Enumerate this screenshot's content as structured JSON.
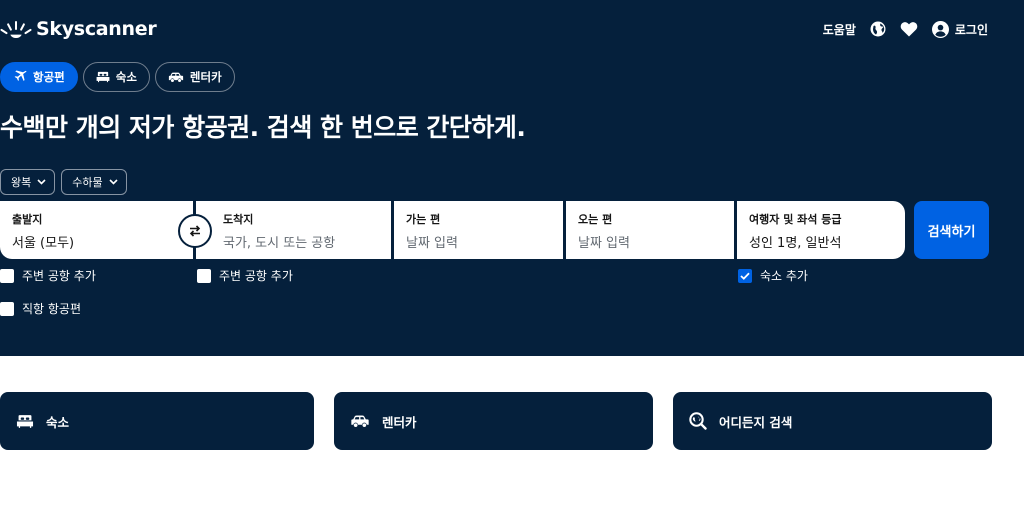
{
  "brand": {
    "name": "Skyscanner",
    "colors": {
      "navy": "#05203c",
      "blue": "#0062e3"
    }
  },
  "header": {
    "help_label": "도움말",
    "globe_icon": "globe-icon",
    "heart_icon": "heart-icon",
    "login_label": "로그인"
  },
  "tabs": [
    {
      "label": "항공편",
      "icon": "plane-icon",
      "active": true
    },
    {
      "label": "숙소",
      "icon": "bed-icon",
      "active": false
    },
    {
      "label": "렌터카",
      "icon": "car-icon",
      "active": false
    }
  ],
  "headline": "수백만 개의 저가 항공권. 검색 한 번으로 간단하게.",
  "trip_options": {
    "trip_type": "왕복",
    "baggage": "수하물"
  },
  "search": {
    "origin": {
      "label": "출발지",
      "value": "서울 (모두)"
    },
    "destination": {
      "label": "도착지",
      "placeholder": "국가, 도시 또는 공항"
    },
    "depart": {
      "label": "가는 편",
      "placeholder": "날짜 입력"
    },
    "return": {
      "label": "오는 편",
      "placeholder": "날짜 입력"
    },
    "travellers": {
      "label": "여행자 및 좌석 등급",
      "value": "성인 1명, 일반석"
    },
    "button_label": "검색하기"
  },
  "checkboxes": {
    "origin_nearby": {
      "label": "주변 공항 추가",
      "checked": false
    },
    "dest_nearby": {
      "label": "주변 공항 추가",
      "checked": false
    },
    "direct": {
      "label": "직항 항공편",
      "checked": false
    },
    "add_hotel": {
      "label": "숙소 추가",
      "checked": true
    }
  },
  "cards": [
    {
      "label": "숙소",
      "icon": "bed-icon"
    },
    {
      "label": "렌터카",
      "icon": "car-icon"
    },
    {
      "label": "어디든지 검색",
      "icon": "explore-icon"
    }
  ]
}
